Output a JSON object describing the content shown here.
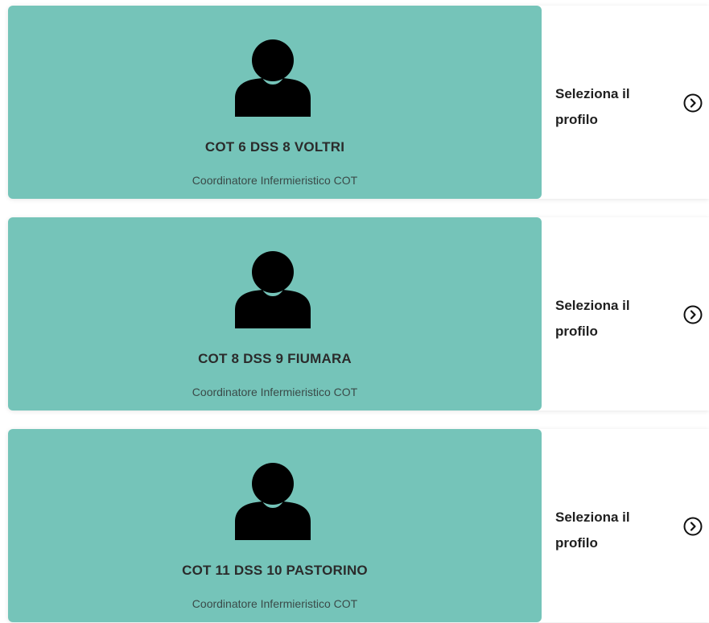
{
  "profiles": [
    {
      "name": "COT 6 DSS 8 VOLTRI",
      "role": "Coordinatore Infermieristico COT",
      "action_label": "Seleziona il profilo",
      "icon": "user-icon",
      "action_icon": "chevron-right-circle-icon"
    },
    {
      "name": "COT 8 DSS 9 FIUMARA",
      "role": "Coordinatore Infermieristico COT",
      "action_label": "Seleziona il profilo",
      "icon": "user-icon",
      "action_icon": "chevron-right-circle-icon"
    },
    {
      "name": "COT 11 DSS 10 PASTORINO",
      "role": "Coordinatore Infermieristico COT",
      "action_label": "Seleziona il profilo",
      "icon": "user-icon",
      "action_icon": "chevron-right-circle-icon"
    }
  ],
  "colors": {
    "panel_background": "#75c4b9",
    "card_background": "#ffffff",
    "text_dark": "#1f1f1f"
  }
}
